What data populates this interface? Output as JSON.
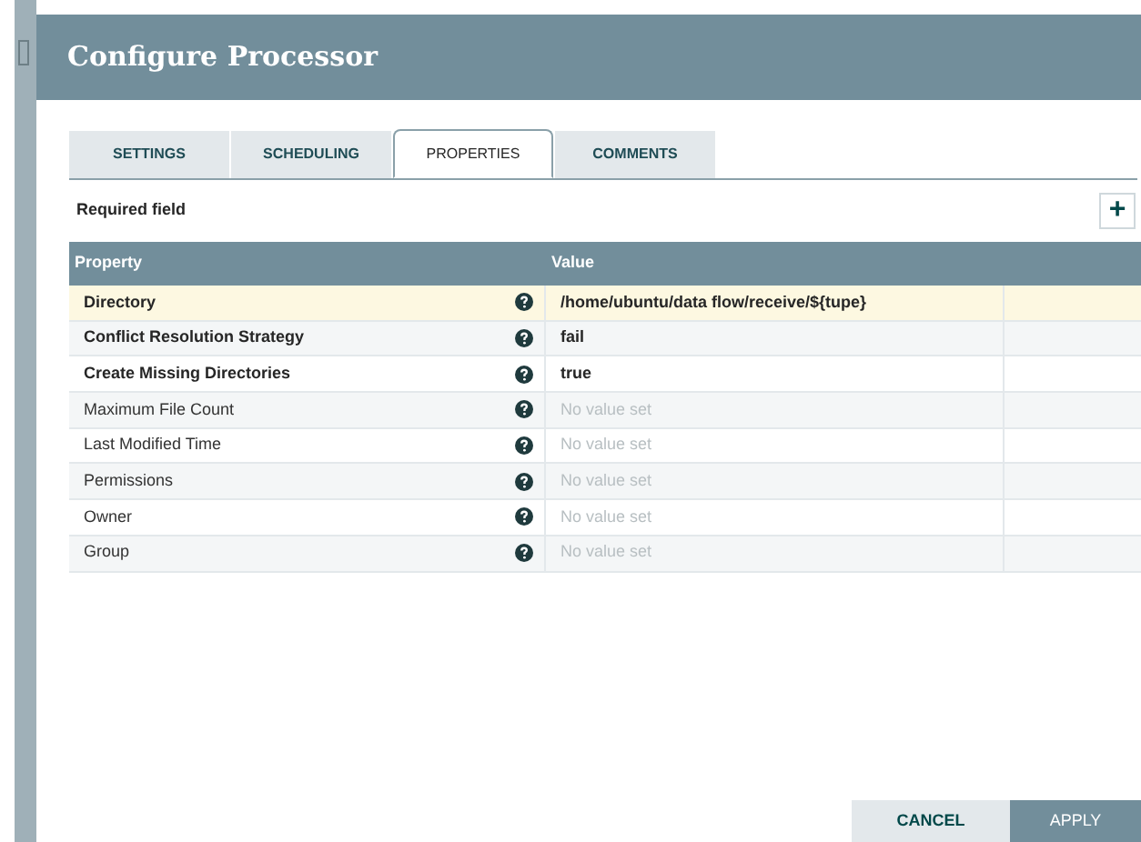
{
  "dialog": {
    "title": "Configure Processor"
  },
  "tabs": [
    {
      "label": "SETTINGS",
      "selected": false
    },
    {
      "label": "SCHEDULING",
      "selected": false
    },
    {
      "label": "PROPERTIES",
      "selected": true
    },
    {
      "label": "COMMENTS",
      "selected": false
    }
  ],
  "required_note": "Required field",
  "add_button": "+",
  "table": {
    "columns": [
      "Property",
      "Value"
    ],
    "rows": [
      {
        "property": "Directory",
        "required": true,
        "value": "/home/ubuntu/data flow/receive/${tupe}",
        "unset": false,
        "selected": true
      },
      {
        "property": "Conflict Resolution Strategy",
        "required": true,
        "value": "fail",
        "unset": false,
        "selected": false
      },
      {
        "property": "Create Missing Directories",
        "required": true,
        "value": "true",
        "unset": false,
        "selected": false
      },
      {
        "property": "Maximum File Count",
        "required": false,
        "value": "No value set",
        "unset": true,
        "selected": false
      },
      {
        "property": "Last Modified Time",
        "required": false,
        "value": "No value set",
        "unset": true,
        "selected": false
      },
      {
        "property": "Permissions",
        "required": false,
        "value": "No value set",
        "unset": true,
        "selected": false
      },
      {
        "property": "Owner",
        "required": false,
        "value": "No value set",
        "unset": true,
        "selected": false
      },
      {
        "property": "Group",
        "required": false,
        "value": "No value set",
        "unset": true,
        "selected": false
      }
    ]
  },
  "buttons": [
    {
      "label": "CANCEL",
      "kind": "secondary"
    },
    {
      "label": "APPLY",
      "kind": "primary"
    }
  ]
}
